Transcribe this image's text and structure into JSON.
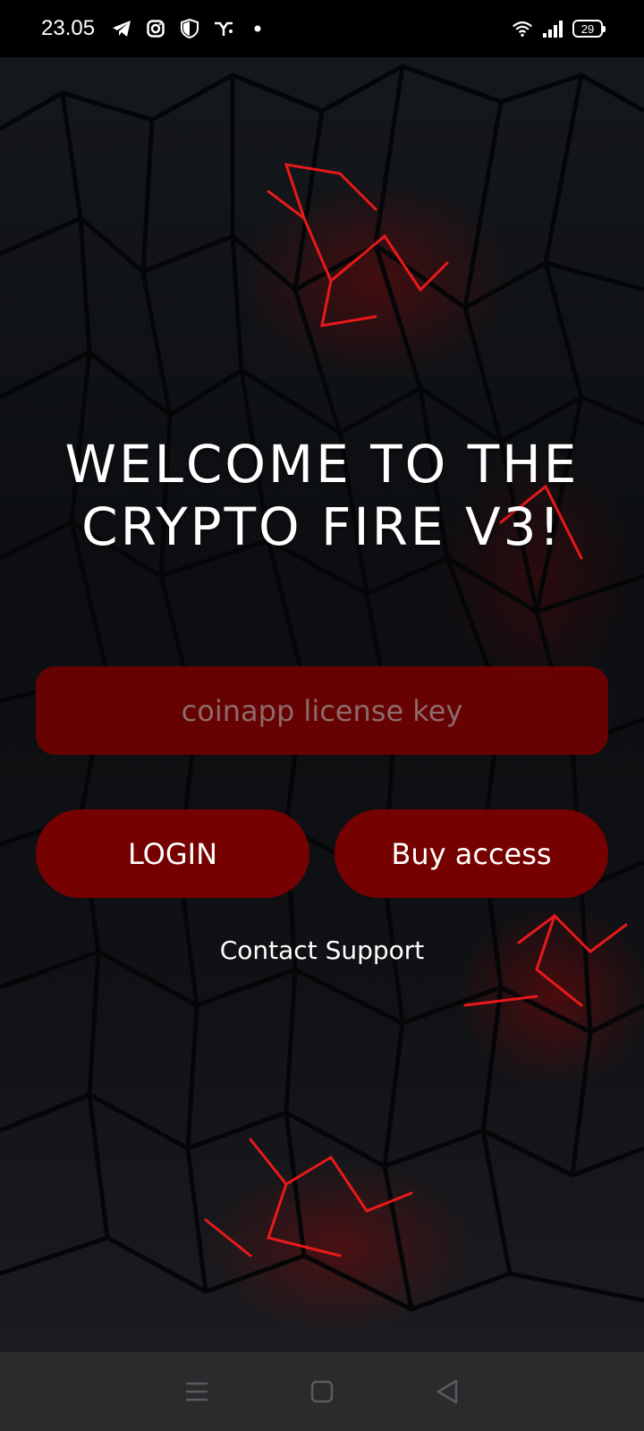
{
  "status_bar": {
    "time": "23.05",
    "left_icons": [
      "telegram-icon",
      "instagram-icon",
      "shield-icon",
      "vpn-icon",
      "dot-icon"
    ],
    "right_icons": [
      "wifi-icon",
      "signal-icon"
    ],
    "battery_level": "29"
  },
  "welcome": {
    "title": "WELCOME TO THE CRYPTO FIRE V3!"
  },
  "login_form": {
    "license_placeholder": "coinapp license key",
    "license_value": "",
    "login_label": "LOGIN",
    "buy_label": "Buy access",
    "support_label": "Contact Support"
  },
  "nav_bar": {
    "buttons": [
      "menu-icon",
      "home-icon",
      "back-icon"
    ]
  },
  "colors": {
    "accent_red": "#7f0000",
    "background": "#101215",
    "nav_bar": "#2a2b2d"
  }
}
